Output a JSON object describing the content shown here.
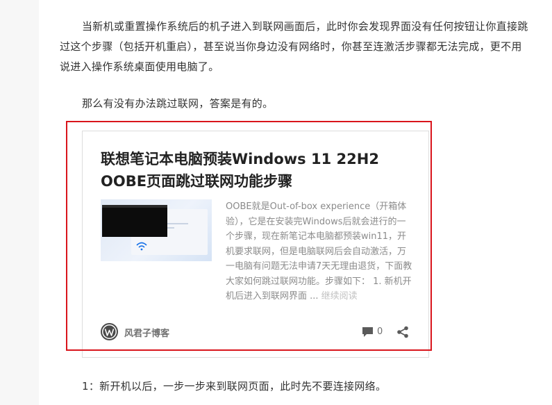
{
  "article": {
    "paragraph_1": "当新机或重置操作系统后的机子进入到联网画面后，此时你会发现界面没有任何按钮让你直接跳过这个步骤（包括开机重启），甚至说当你身边没有网络时，你甚至连激活步骤都无法完成，更不用说进入操作系统桌面使用电脑了。",
    "paragraph_2": "那么有没有办法跳过联网，答案是有的。",
    "paragraph_3": "1：新开机以后，一步一步来到联网页面，此时先不要连接网络。"
  },
  "embed_card": {
    "title": "联想笔记本电脑预装Windows 11 22H2 OOBE页面跳过联网功能步骤",
    "excerpt": "OOBE就是Out-of-box experience（开箱体验），它是在安装完Windows后就会进行的一个步骤，现在新笔记本电脑都预装win11，开机要求联网，但是电脑联网后会自动激活，万一电脑有问题无法申请7天无理由退货，下面教大家如何跳过联网功能。步骤如下： 1. 新机开机后进入到联网界面 ...",
    "read_more": "继续阅读",
    "site_name": "风君子博客",
    "comment_count": "0",
    "site_logo_icon": "wordpress-icon",
    "comment_icon": "comment-bubble-icon",
    "share_icon": "share-icon"
  },
  "colors": {
    "highlight_border": "#d9141b",
    "title_text": "#222222",
    "excerpt_text": "#8b8b8b",
    "footer_text": "#707070"
  }
}
